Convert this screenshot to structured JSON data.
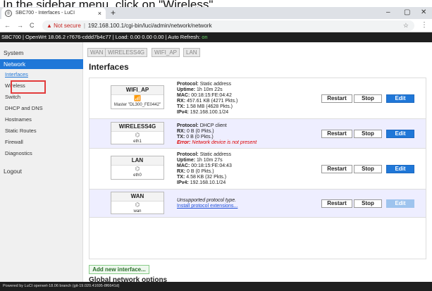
{
  "caption": "In the sidebar menu, click on \"Wireless\".",
  "browser": {
    "tab_title": "SBC700 - Interfaces - LuCI",
    "tab_close": "×",
    "new_tab": "+",
    "minimize": "–",
    "maximize": "▢",
    "close": "✕",
    "back": "←",
    "forward": "→",
    "reload": "C",
    "not_secure": "Not secure",
    "url": "192.168.100.1/cgi-bin/luci/admin/network/network",
    "star": "☆",
    "menu": "⋮"
  },
  "status": {
    "text": "SBC700 | OpenWrt 18.06.2 r7676-cddd7b4c77 | Load: 0.00 0.00 0.00 | Auto Refresh:",
    "refresh": "on"
  },
  "sidebar": {
    "system": "System",
    "network": "Network",
    "items": [
      "Interfaces",
      "Wireless",
      "Switch",
      "DHCP and DNS",
      "Hostnames",
      "Static Routes",
      "Firewall",
      "Diagnostics"
    ],
    "logout": "Logout"
  },
  "tabs": [
    "WAN",
    "WIRELESS4G",
    "WIFI_AP",
    "LAN"
  ],
  "page_title": "Interfaces",
  "labels": {
    "protocol": "Protocol:",
    "uptime": "Uptime:",
    "mac": "MAC:",
    "rx": "RX:",
    "tx": "TX:",
    "ipv4": "IPv4:"
  },
  "interfaces": [
    {
      "name": "WIFI_AP",
      "device": "Master \"DL300_FE0442\"",
      "protocol": "Static address",
      "uptime": "1h 10m 22s",
      "mac": "00:18:15:FE:04:42",
      "rx": "457.61 KB (4271 Pkts.)",
      "tx": "1.58 MB (4628 Pkts.)",
      "ipv4": "192.168.100.1/24"
    },
    {
      "name": "WIRELESS4G",
      "device": "eth1",
      "protocol": "DHCP client",
      "rx": "0 B (0 Pkts.)",
      "tx": "0 B (0 Pkts.)",
      "error_label": "Error:",
      "error": "Network device is not present"
    },
    {
      "name": "LAN",
      "device": "eth0",
      "protocol": "Static address",
      "uptime": "1h 10m 27s",
      "mac": "00:18:15:FE:04:43",
      "rx": "0 B (0 Pkts.)",
      "tx": "4.58 KB (32 Pkts.)",
      "ipv4": "192.168.10.1/24"
    },
    {
      "name": "WAN",
      "device": "wan",
      "unsupported": "Unsupported protocol type.",
      "install_link": "Install protocol extensions..."
    }
  ],
  "buttons": {
    "restart": "Restart",
    "stop": "Stop",
    "edit": "Edit",
    "add_interface": "Add new interface..."
  },
  "global_title": "Global network options",
  "footer": "Powered by LuCI openwrt-18.06 branch (git-19.020.41695-8f6641d)"
}
